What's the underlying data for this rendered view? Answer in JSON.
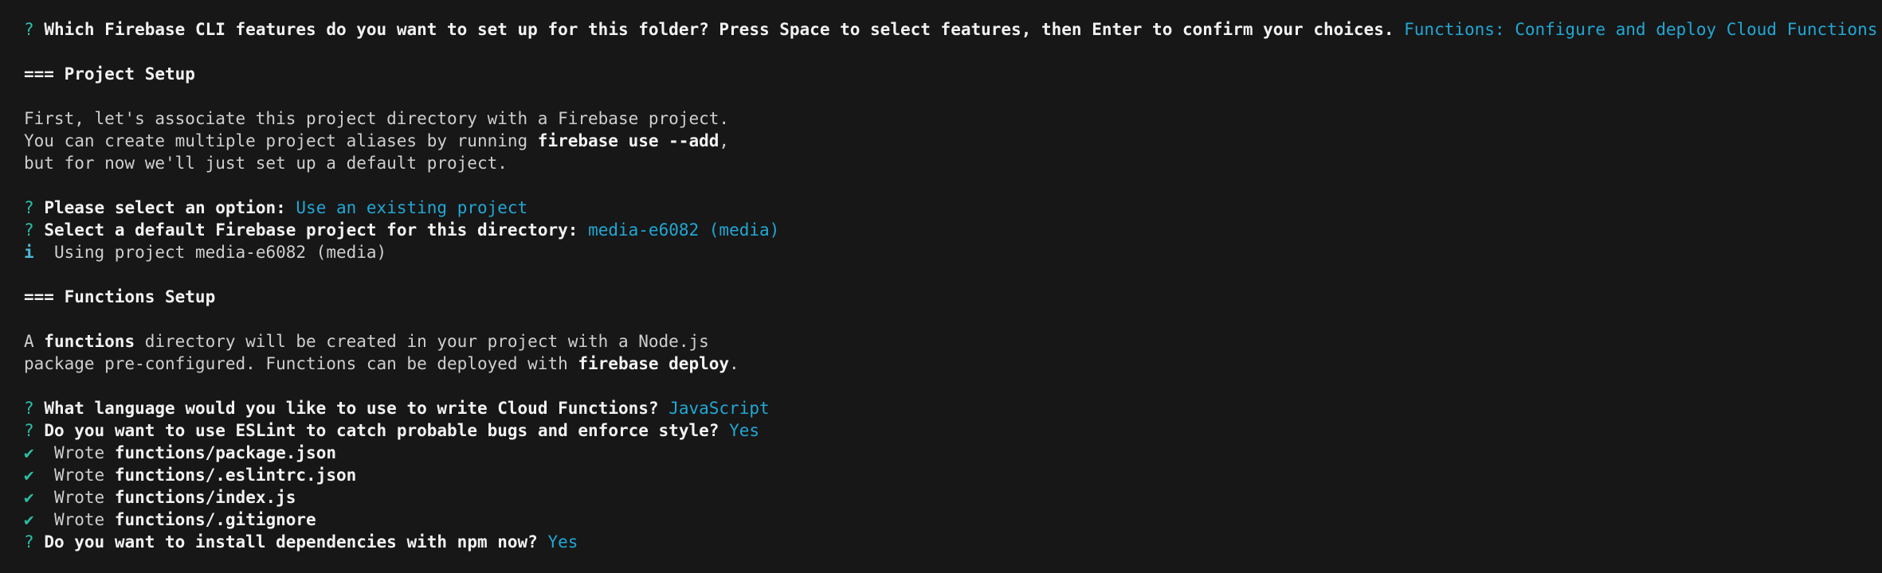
{
  "glyphs": {
    "question": "?",
    "info": "i",
    "check": "✔"
  },
  "lines": {
    "features_prompt": "Which Firebase CLI features do you want to set up for this folder? Press Space to select features, then Enter to confirm your choices.",
    "features_answer": "Functions: Configure and deploy Cloud Functions",
    "project_heading": "=== Project Setup",
    "intro_1": "First, let's associate this project directory with a Firebase project.",
    "intro_2_pre": "You can create multiple project aliases by running ",
    "intro_2_cmd": "firebase use --add",
    "intro_2_post": ",",
    "intro_3": "but for now we'll just set up a default project.",
    "option_prompt": "Please select an option:",
    "option_answer": "Use an existing project",
    "default_prompt": "Select a default Firebase project for this directory:",
    "default_answer": "media-e6082 (media)",
    "using_project": "Using project media-e6082 (media)",
    "functions_heading": "=== Functions Setup",
    "fn_intro_1_pre": "A ",
    "fn_intro_1_bold": "functions",
    "fn_intro_1_post": " directory will be created in your project with a Node.js",
    "fn_intro_2_pre": "package pre-configured. Functions can be deployed with ",
    "fn_intro_2_cmd": "firebase deploy",
    "fn_intro_2_post": ".",
    "language_prompt": "What language would you like to use to write Cloud Functions?",
    "language_answer": "JavaScript",
    "eslint_prompt": "Do you want to use ESLint to catch probable bugs and enforce style?",
    "eslint_answer": "Yes",
    "wrote_label": "Wrote",
    "wrote_files": [
      "functions/package.json",
      "functions/.eslintrc.json",
      "functions/index.js",
      "functions/.gitignore"
    ],
    "npm_prompt": "Do you want to install dependencies with npm now?",
    "npm_answer": "Yes"
  }
}
